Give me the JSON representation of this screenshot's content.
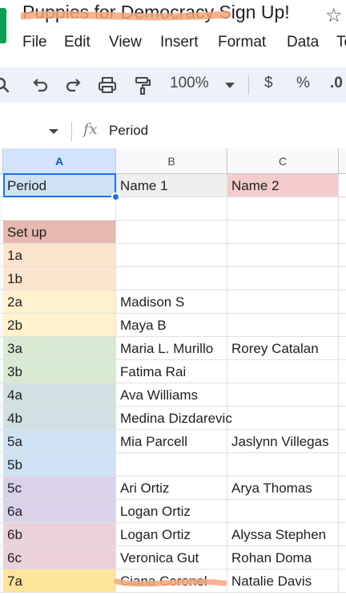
{
  "app": {
    "title": "Puppies for Democracy Sign Up!"
  },
  "menu": [
    "File",
    "Edit",
    "View",
    "Insert",
    "Format",
    "Data",
    "To"
  ],
  "toolbar": {
    "zoom": "100%",
    "currency": "$",
    "percent": "%",
    "decimal": ".0"
  },
  "formula_bar": {
    "fx": "fx",
    "value": "Period"
  },
  "columns": [
    "A",
    "B",
    "C"
  ],
  "colors": {
    "header_a": "#cfe2f3",
    "header_b": "#efefef",
    "header_c": "#f4cccc",
    "setup": "#e6b8af",
    "peach": "#fce5cd",
    "yellow": "#fff2cc",
    "green": "#d9ead3",
    "teal": "#d0e0e3",
    "blue": "#cfe2f3",
    "purple": "#d9d2e9",
    "pink": "#ead1dc",
    "gold": "#ffe599",
    "scribble": "#f4a77a"
  },
  "rows": [
    {
      "a": "Period",
      "b": "Name 1",
      "c": "Name 2",
      "ca": "header_a",
      "cb": "header_b",
      "cc": "header_c"
    },
    {
      "a": "",
      "b": "",
      "c": "",
      "ca": "",
      "cb": "",
      "cc": ""
    },
    {
      "a": "Set up",
      "b": "",
      "c": "",
      "ca": "setup",
      "cb": "",
      "cc": ""
    },
    {
      "a": "1a",
      "b": "",
      "c": "",
      "ca": "peach",
      "cb": "",
      "cc": ""
    },
    {
      "a": "1b",
      "b": "",
      "c": "",
      "ca": "peach",
      "cb": "",
      "cc": ""
    },
    {
      "a": "2a",
      "b": "Madison S",
      "c": "",
      "ca": "yellow",
      "cb": "",
      "cc": ""
    },
    {
      "a": "2b",
      "b": "Maya B",
      "c": "",
      "ca": "yellow",
      "cb": "",
      "cc": ""
    },
    {
      "a": "3a",
      "b": "Maria L. Murillo",
      "c": "Rorey Catalan",
      "ca": "green",
      "cb": "",
      "cc": ""
    },
    {
      "a": "3b",
      "b": "Fatima Rai",
      "c": "",
      "ca": "green",
      "cb": "",
      "cc": ""
    },
    {
      "a": "4a",
      "b": "Ava Williams",
      "c": "",
      "ca": "teal",
      "cb": "",
      "cc": ""
    },
    {
      "a": "4b",
      "b": "Medina Dizdarevic",
      "c": "",
      "ca": "teal",
      "cb": "",
      "cc": ""
    },
    {
      "a": "5a",
      "b": "Mia Parcell",
      "c": "Jaslynn Villegas",
      "ca": "blue",
      "cb": "",
      "cc": ""
    },
    {
      "a": "5b",
      "b": "",
      "c": "",
      "ca": "blue",
      "cb": "",
      "cc": ""
    },
    {
      "a": "5c",
      "b": "Ari Ortiz",
      "c": "Arya Thomas",
      "ca": "purple",
      "cb": "",
      "cc": ""
    },
    {
      "a": "6a",
      "b": "Logan Ortiz",
      "c": "",
      "ca": "purple",
      "cb": "",
      "cc": ""
    },
    {
      "a": "6b",
      "b": "Logan Ortiz",
      "c": "Alyssa Stephen",
      "ca": "pink",
      "cb": "",
      "cc": ""
    },
    {
      "a": "6c",
      "b": "Veronica Gut",
      "c": "Rohan Doma",
      "ca": "pink",
      "cb": "",
      "cc": ""
    },
    {
      "a": "7a",
      "b": "Ciana Coronel",
      "c": "Natalie Davis",
      "ca": "gold",
      "cb": "",
      "cc": ""
    }
  ]
}
